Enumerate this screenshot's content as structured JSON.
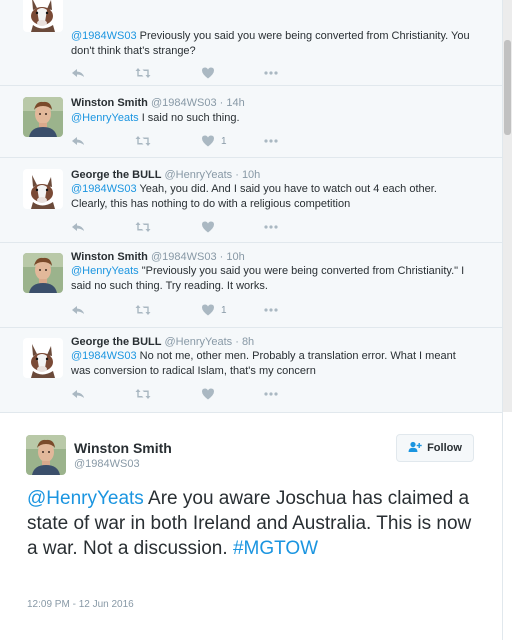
{
  "replies": [
    {
      "name": "",
      "handle": "",
      "time": "",
      "mention": "@1984WS03",
      "text": " Previously you said you were being converted from Christianity. You don't think that's strange?",
      "like_count": ""
    },
    {
      "name": "Winston Smith",
      "handle": "@1984WS03",
      "time": "· 14h",
      "mention": "@HenryYeats",
      "text": " I said no such thing.",
      "like_count": "1"
    },
    {
      "name": "George the BULL",
      "handle": "@HenryYeats",
      "time": "· 10h",
      "mention": "@1984WS03",
      "text": " Yeah, you did. And I said you have to watch out 4 each other. Clearly, this has nothing to do with a religious competition",
      "like_count": ""
    },
    {
      "name": "Winston Smith",
      "handle": "@1984WS03",
      "time": "· 10h",
      "mention": "@HenryYeats",
      "text": " \"Previously you said you were being converted from Christianity.\" I said no such thing. Try reading. It works.",
      "like_count": "1"
    },
    {
      "name": "George the BULL",
      "handle": "@HenryYeats",
      "time": "· 8h",
      "mention": "@1984WS03",
      "text": " No not me, other men. Probably a translation error. What I meant was conversion to radical Islam, that's my concern",
      "like_count": ""
    }
  ],
  "main_tweet": {
    "name": "Winston Smith",
    "handle": "@1984WS03",
    "follow_label": "Follow",
    "mention": "@HenryYeats",
    "text": " Are you aware Joschua has claimed a state of war in both Ireland and Australia. This is now a war. Not a discussion. ",
    "hashtag": "#MGTOW",
    "timestamp": "12:09 PM - 12 Jun 2016"
  },
  "colors": {
    "link": "#1b95e0",
    "muted": "#8899a6",
    "text": "#292f33",
    "thread_bg": "#f5f8fa"
  },
  "icons": {
    "reply": "reply-icon",
    "retweet": "retweet-icon",
    "like": "heart-icon",
    "more": "more-icon",
    "follow": "add-user-icon"
  }
}
